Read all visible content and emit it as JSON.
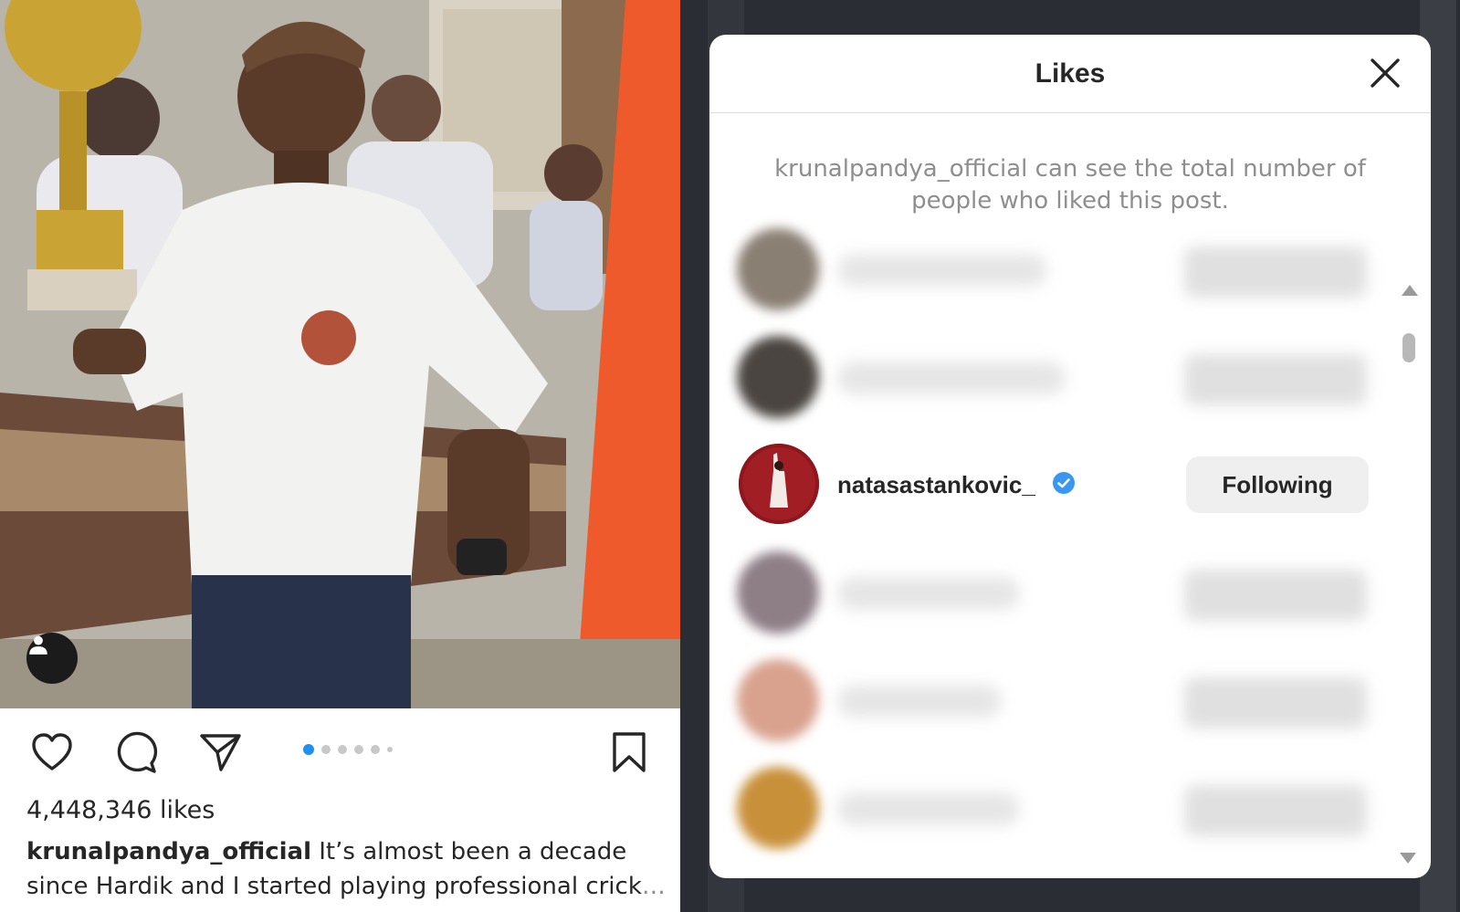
{
  "post": {
    "likes_text": "4,448,346 likes",
    "caption_user": "krunalpandya_official",
    "caption_text": " It’s almost been a decade since Hardik and I started playing professional crick",
    "caption_more": "… more",
    "carousel": {
      "count": 6,
      "active_index": 0
    }
  },
  "modal": {
    "title": "Likes",
    "notice": "krunalpandya_official can see the total number of people who liked this post.",
    "visible_user": {
      "username": "natasastankovic_",
      "verified": true,
      "follow_label": "Following"
    }
  },
  "colors": {
    "accent": "#1f8ff0",
    "verified": "#3897f0",
    "text": "#262626",
    "muted": "#8e8e8e"
  },
  "icons": [
    "heart-icon",
    "comment-icon",
    "share-icon",
    "bookmark-icon",
    "close-icon",
    "verified-icon",
    "user-tag-icon"
  ]
}
